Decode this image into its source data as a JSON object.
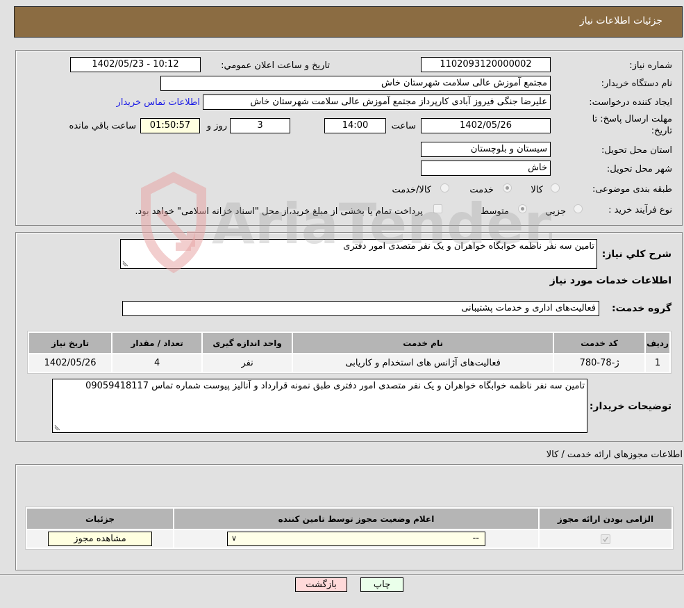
{
  "header": {
    "title": "جزئیات اطلاعات نیاز"
  },
  "form": {
    "need_number": {
      "label": "شماره نیاز:",
      "value": "1102093120000002"
    },
    "announce_datetime": {
      "label": "تاريخ و ساعت اعلان عمومي:",
      "value": "1402/05/23 - 10:12"
    },
    "buyer_org": {
      "label": "نام دستگاه خريدار:",
      "value": "مجتمع آموزش عالی سلامت شهرستان خاش"
    },
    "requester": {
      "label": "ايجاد کننده درخواست:",
      "value": "علیرضا جنگی فیروز آبادی کارپرداز مجتمع آموزش عالی سلامت شهرستان خاش",
      "contact_link": "اطلاعات تماس خريدار"
    },
    "deadline": {
      "label": "مهلت ارسال پاسخ: تا تاريخ:",
      "date": "1402/05/26",
      "time_label": "ساعت",
      "time": "14:00",
      "days": "3",
      "days_label": "روز و",
      "remaining": "01:50:57",
      "remaining_label": "ساعت باقي مانده"
    },
    "province": {
      "label": "استان محل تحويل:",
      "value": "سیستان و بلوچستان"
    },
    "city": {
      "label": "شهر محل تحويل:",
      "value": "خاش"
    },
    "category": {
      "label": "طبقه بندی موضوعی:",
      "options": [
        "کالا",
        "خدمت",
        "کالا/خدمت"
      ],
      "selected": "خدمت"
    },
    "process": {
      "label": "نوع فرآيند خريد :",
      "options": [
        "جزيي",
        "متوسط"
      ],
      "selected": "متوسط",
      "treasury_note": "پرداخت تمام يا بخشی از مبلغ خريد،از محل \"اسناد خزانه اسلامی\" خواهد بود.",
      "treasury_checked": false
    }
  },
  "services": {
    "description_label": "شرح کلي نياز:",
    "description": "تامین سه نفر ناظمه خوابگاه خواهران و یک نفر متصدی امور دفتری",
    "section_title": "اطلاعات خدمات مورد نياز",
    "group_label": "گروه خدمت:",
    "group_value": "فعالیت‌های اداری و خدمات پشتیبانی",
    "table": {
      "headers": [
        "رديف",
        "کد خدمت",
        "نام خدمت",
        "واحد اندازه گيری",
        "تعداد / مقدار",
        "تاريخ نياز"
      ],
      "rows": [
        [
          "1",
          "ژ-78-780",
          "فعالیت‌های آژانس های استخدام و کاریابی",
          "نفر",
          "4",
          "1402/05/26"
        ]
      ]
    },
    "buyer_notes_label": "توضيحات خريدار:",
    "buyer_notes": "تامین سه نفر ناظمه خوابگاه خواهران و یک نفر متصدی امور دفتری طبق نمونه قرارداد و آنالیز پیوست شماره تماس 09059418117"
  },
  "permits": {
    "section_title": "اطلاعات مجوزهای ارائه خدمت / کالا",
    "headers": [
      "الزامی بودن ارائه مجوز",
      "اعلام وضعيت مجوز توسط تامين کننده",
      "جزئيات"
    ],
    "row": {
      "required_checked": true,
      "status_select": "--",
      "details_button": "مشاهده مجوز"
    }
  },
  "footer": {
    "print_button": "چاپ",
    "back_button": "بازگشت"
  },
  "watermark": {
    "text": "AriaTender.neT"
  },
  "colors": {
    "header": "#8b6c42",
    "back_button": "#ffd9d9",
    "print_button": "#eaffea",
    "remaining_box": "#ffffe0",
    "link": "#1a1ae6"
  }
}
